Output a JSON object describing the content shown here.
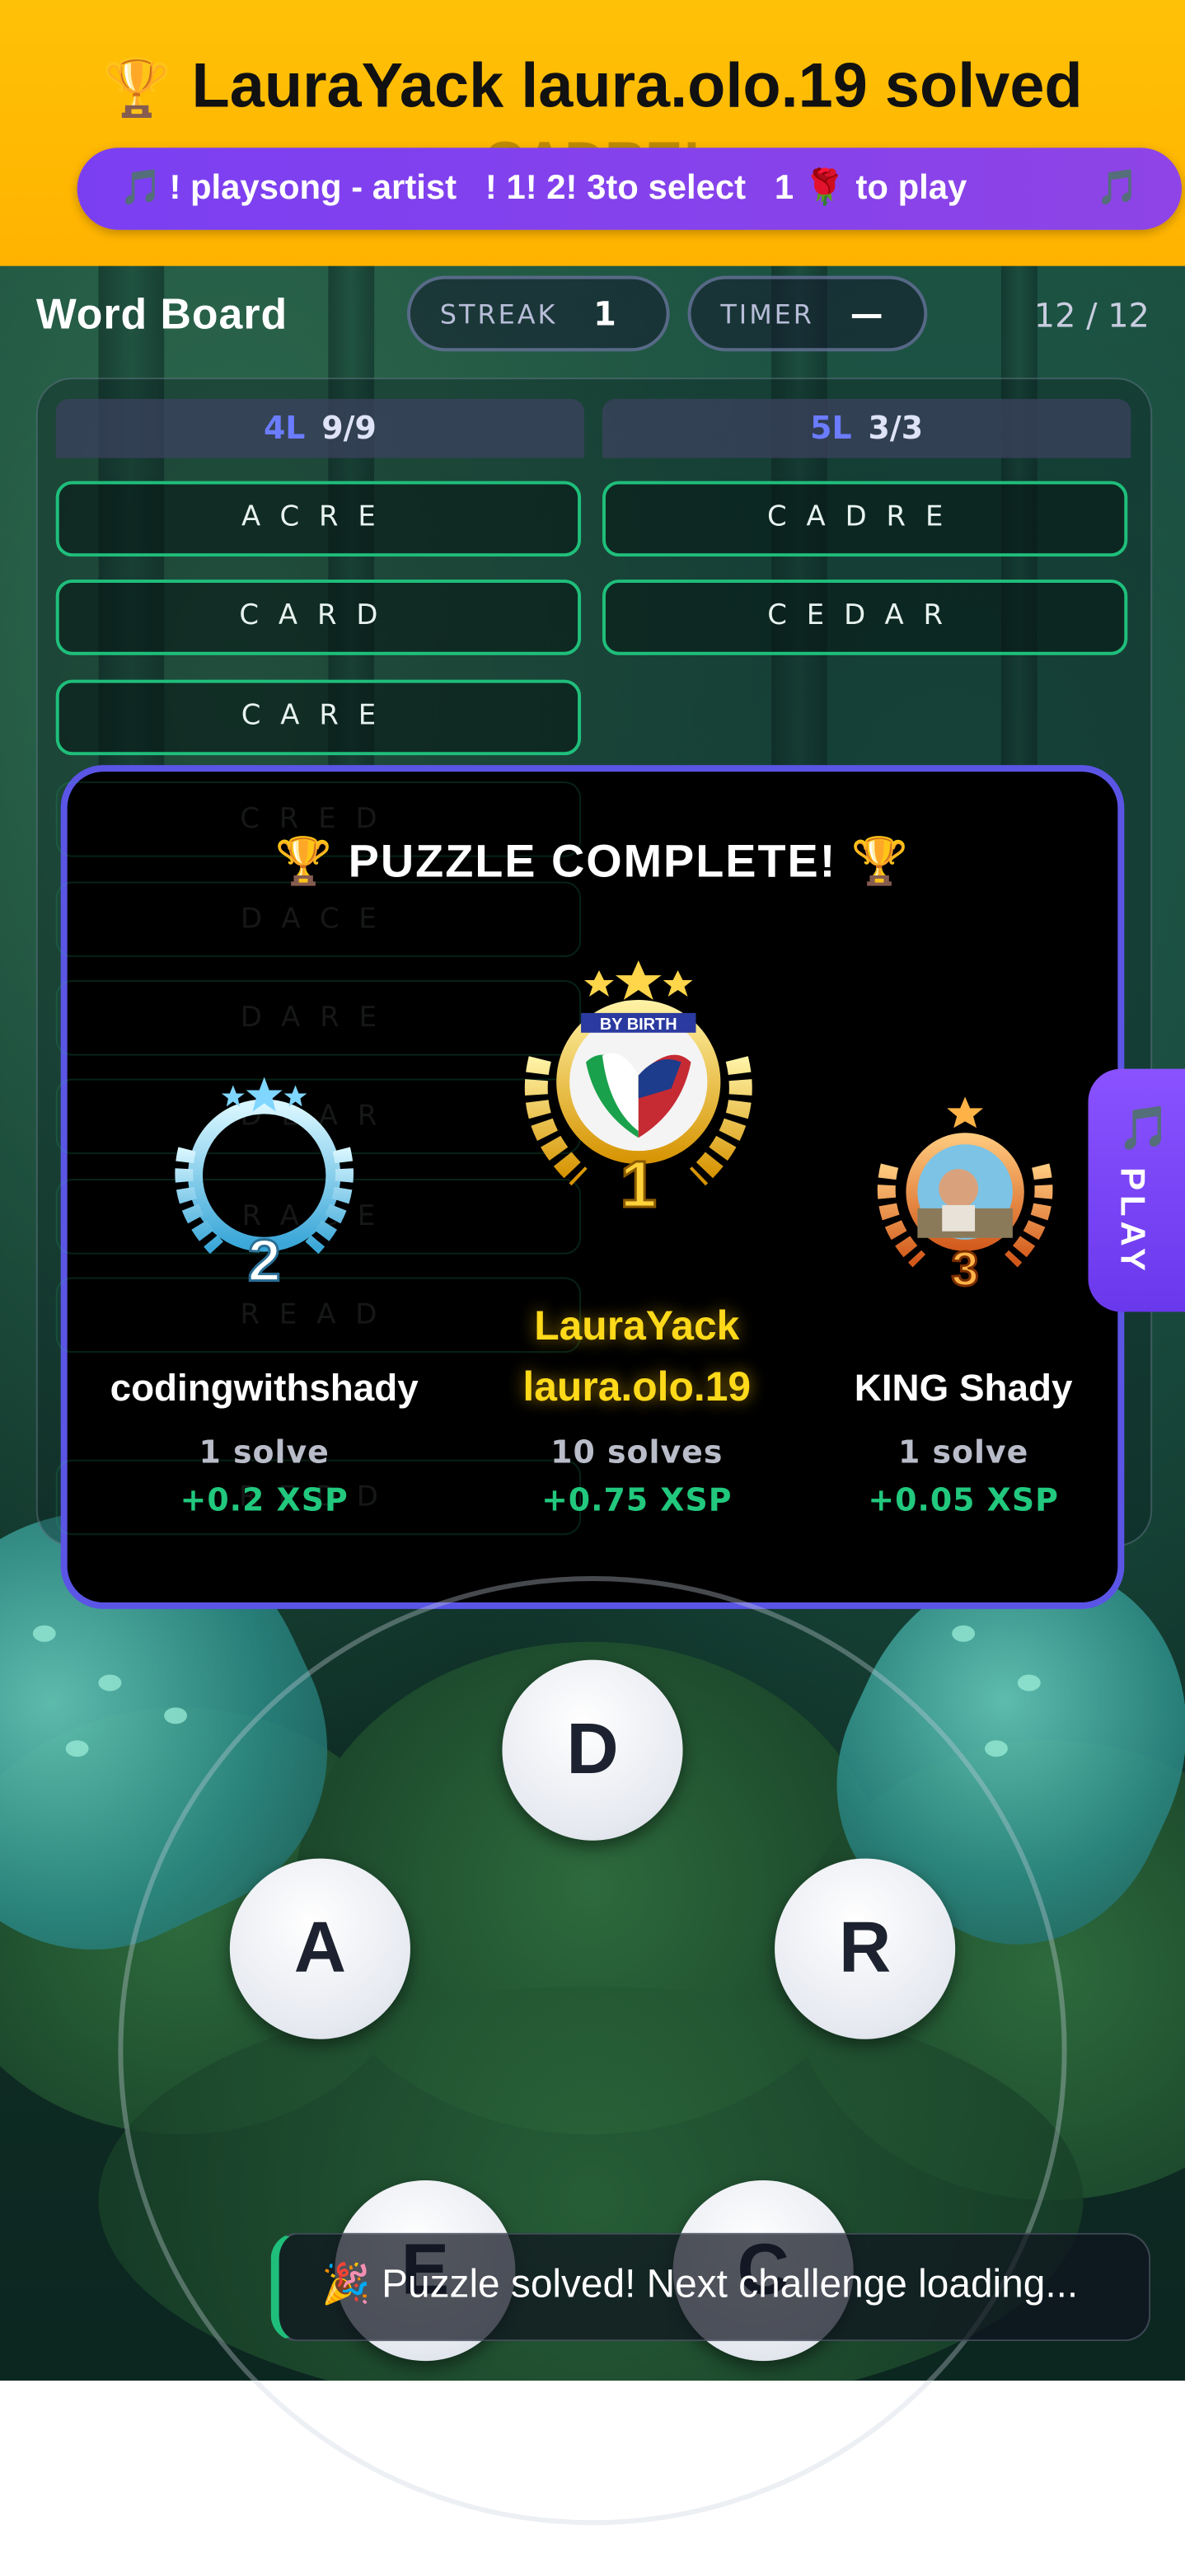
{
  "banner": {
    "trophy_icon": "🏆",
    "title": "LauraYack laura.olo.19 solved",
    "subtitle_ghost": "CADRE!"
  },
  "song_bar": {
    "note_left": "🎵",
    "text": "! playsong - artist   ! 1! 2! 3to select   1 🌹 to play",
    "note_right": "🎵"
  },
  "header": {
    "title": "Word Board",
    "streak_label": "STREAK",
    "streak_value": "1",
    "timer_label": "TIMER",
    "timer_value": "—",
    "progress": "12 / 12"
  },
  "columns": [
    {
      "len_label": "4L",
      "count": "9/9",
      "words": [
        "ACRE",
        "CARD",
        "CARE",
        "CRED",
        "DACE",
        "DARE",
        "DEAR",
        "RACE",
        "READ",
        "REDD"
      ]
    },
    {
      "len_label": "5L",
      "count": "3/3",
      "words": [
        "CADRE",
        "CEDAR"
      ]
    }
  ],
  "modal": {
    "title": "🏆  PUZZLE COMPLETE!  🏆",
    "podium": [
      {
        "rank": 2,
        "name": "codingwithshady",
        "solves": "1 solve",
        "xsp": "+0.2 XSP"
      },
      {
        "rank": 1,
        "name_line1": "LauraYack",
        "name_line2": "laura.olo.19",
        "solves": "10 solves",
        "xsp": "+0.75 XSP",
        "badge_text": "BY BIRTH"
      },
      {
        "rank": 3,
        "name": "KING Shady",
        "solves": "1 solve",
        "xsp": "+0.05 XSP"
      }
    ]
  },
  "play_tab": {
    "note": "🎵",
    "label": "PLAY"
  },
  "wheel": {
    "letters": [
      "D",
      "A",
      "R",
      "E",
      "C"
    ]
  },
  "toast": {
    "text": "🎉 Puzzle solved! Next challenge loading..."
  },
  "colors": {
    "banner": "#ffb300",
    "accent": "#5b55e6",
    "tile_border": "#1fbf7b",
    "gold": "#ffd91a",
    "xsp": "#21c87d"
  }
}
